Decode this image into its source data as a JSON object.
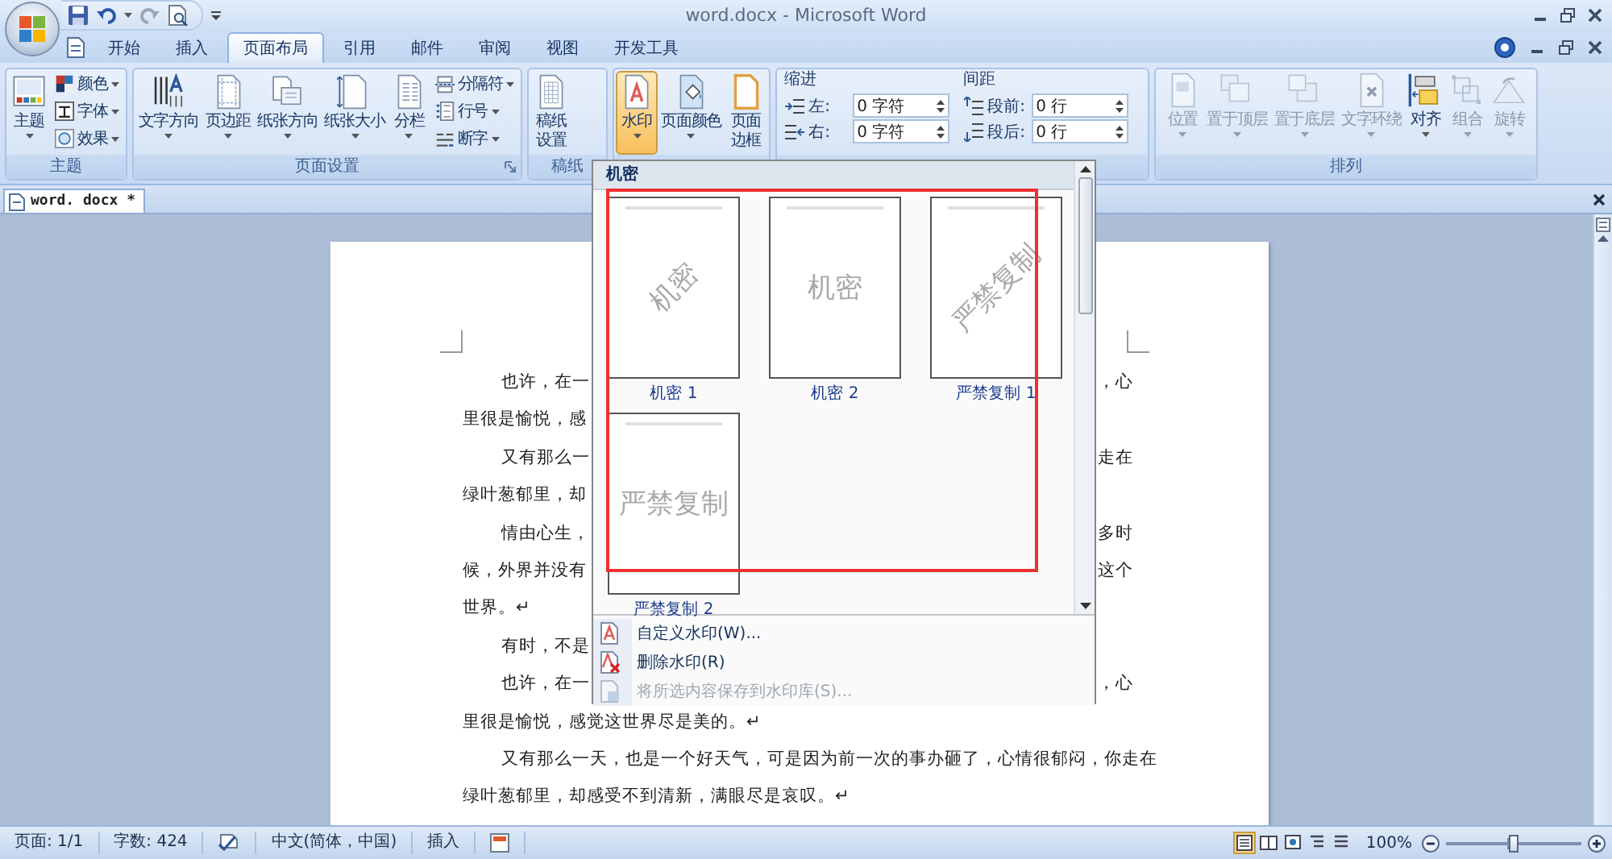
{
  "title_bar": {
    "title": "word.docx - Microsoft Word"
  },
  "tabs": [
    {
      "label": "开始",
      "selected": false
    },
    {
      "label": "插入",
      "selected": false
    },
    {
      "label": "页面布局",
      "selected": true
    },
    {
      "label": "引用",
      "selected": false
    },
    {
      "label": "邮件",
      "selected": false
    },
    {
      "label": "审阅",
      "selected": false
    },
    {
      "label": "视图",
      "selected": false
    },
    {
      "label": "开发工具",
      "selected": false
    }
  ],
  "ribbon": {
    "groups": [
      {
        "label": "主题",
        "launcher": false,
        "items": [
          {
            "kind": "large",
            "label": "主题",
            "dropdown": true,
            "disabled": false,
            "pressed": false
          },
          {
            "kind": "small",
            "label": "颜色",
            "dropdown": true,
            "disabled": false,
            "pressed": false
          },
          {
            "kind": "small",
            "label": "字体",
            "dropdown": true,
            "disabled": false,
            "pressed": false
          },
          {
            "kind": "small",
            "label": "效果",
            "dropdown": true,
            "disabled": false,
            "pressed": false
          }
        ]
      },
      {
        "label": "页面设置",
        "launcher": true,
        "items": [
          {
            "kind": "large",
            "label": "文字方向",
            "dropdown": true,
            "disabled": false,
            "pressed": false
          },
          {
            "kind": "large",
            "label": "页边距",
            "dropdown": true,
            "disabled": false,
            "pressed": false
          },
          {
            "kind": "large",
            "label": "纸张方向",
            "dropdown": true,
            "disabled": false,
            "pressed": false
          },
          {
            "kind": "large",
            "label": "纸张大小",
            "dropdown": true,
            "disabled": false,
            "pressed": false
          },
          {
            "kind": "large",
            "label": "分栏",
            "dropdown": true,
            "disabled": false,
            "pressed": false
          },
          {
            "kind": "small",
            "label": "分隔符",
            "dropdown": true,
            "disabled": false,
            "pressed": false
          },
          {
            "kind": "small",
            "label": "行号",
            "dropdown": true,
            "disabled": false,
            "pressed": false
          },
          {
            "kind": "small",
            "label": "断字",
            "dropdown": true,
            "disabled": false,
            "pressed": false
          }
        ]
      },
      {
        "label": "稿纸",
        "launcher": false,
        "items": [
          {
            "kind": "large",
            "label": "稿纸设置",
            "dropdown": false,
            "disabled": false,
            "pressed": false
          }
        ]
      },
      {
        "launcher": false,
        "items": [
          {
            "kind": "large",
            "label": "水印",
            "dropdown": true,
            "disabled": false,
            "pressed": true
          },
          {
            "kind": "large",
            "label": "页面颜色",
            "dropdown": true,
            "disabled": false,
            "pressed": false
          },
          {
            "kind": "large",
            "label": "页面边框",
            "dropdown": false,
            "disabled": false,
            "pressed": false
          }
        ]
      },
      {
        "launcher": false,
        "items": [
          {
            "kind": "heading",
            "label": "缩进"
          },
          {
            "kind": "spin",
            "label": "左:",
            "value": "0 字符"
          },
          {
            "kind": "spin",
            "label": "右:",
            "value": "0 字符"
          },
          {
            "kind": "heading",
            "label": "间距"
          },
          {
            "kind": "spin",
            "label": "段前:",
            "value": "0 行"
          },
          {
            "kind": "spin",
            "label": "段后:",
            "value": "0 行"
          }
        ]
      },
      {
        "label": "排列",
        "launcher": false,
        "items": [
          {
            "kind": "large",
            "label": "位置",
            "dropdown": true,
            "disabled": true,
            "pressed": false
          },
          {
            "kind": "large",
            "label": "置于顶层",
            "dropdown": true,
            "disabled": true,
            "pressed": false
          },
          {
            "kind": "large",
            "label": "置于底层",
            "dropdown": true,
            "disabled": true,
            "pressed": false
          },
          {
            "kind": "large",
            "label": "文字环绕",
            "dropdown": true,
            "disabled": true,
            "pressed": false
          },
          {
            "kind": "large",
            "label": "对齐",
            "dropdown": true,
            "disabled": false,
            "pressed": false
          },
          {
            "kind": "large",
            "label": "组合",
            "dropdown": true,
            "disabled": true,
            "pressed": false
          },
          {
            "kind": "large",
            "label": "旋转",
            "dropdown": true,
            "disabled": true,
            "pressed": false
          }
        ]
      }
    ]
  },
  "document_tabs": [
    {
      "label": "word. docx *",
      "selected": true
    }
  ],
  "document": {
    "lines": [
      {
        "indent": true,
        "left": "也许，在一",
        "right": "，心"
      },
      {
        "indent": false,
        "left": "里很是愉悦，感"
      },
      {
        "indent": true,
        "left": "又有那么一",
        "right": "走在"
      },
      {
        "indent": false,
        "left": "绿叶葱郁里，却"
      },
      {
        "indent": true,
        "left": "情由心生，",
        "right": "多时"
      },
      {
        "indent": false,
        "left": "候，外界并没有",
        "right": "这个"
      },
      {
        "indent": false,
        "left": "世界。↵"
      },
      {
        "indent": true,
        "left": "有时，不是"
      },
      {
        "indent": true,
        "left": "也许，在一",
        "right": "，心"
      },
      {
        "indent": false,
        "left": "里很是愉悦，感觉这世界尽是美的。↵"
      },
      {
        "indent": true,
        "left": "又有那么一天，也是一个好天气，可是因为前一次的事办砸了，心情很郁闷，你走在"
      },
      {
        "indent": false,
        "left": "绿叶葱郁里，却感受不到清新，满眼尽是哀叹。↵"
      }
    ]
  },
  "watermark_menu": {
    "section": "机密",
    "gallery": [
      {
        "label": "机密 1",
        "preview": "机密",
        "diagonal": true
      },
      {
        "label": "机密 2",
        "preview": "机密",
        "diagonal": false
      },
      {
        "label": "严禁复制 1",
        "preview": "严禁复制",
        "diagonal": true
      },
      {
        "label": "严禁复制 2",
        "preview": "严禁复制",
        "diagonal": false
      }
    ],
    "commands": [
      {
        "label": "自定义水印(W)...",
        "disabled": false
      },
      {
        "label": "删除水印(R)",
        "disabled": false
      },
      {
        "label": "将所选内容保存到水印库(S)...",
        "disabled": true
      }
    ]
  },
  "status_bar": {
    "items": [
      {
        "kind": "text",
        "label": "页面: 1/1"
      },
      {
        "kind": "text",
        "label": "字数: 424"
      },
      {
        "kind": "proofing"
      },
      {
        "kind": "text",
        "label": "中文(简体，中国)"
      },
      {
        "kind": "text",
        "label": "插入"
      },
      {
        "kind": "macro"
      }
    ],
    "view_buttons": [
      {
        "selected": true
      },
      {
        "selected": false
      },
      {
        "selected": false
      },
      {
        "selected": false
      },
      {
        "selected": false
      }
    ],
    "zoom": {
      "reading": "100%",
      "level": 0.5
    }
  }
}
